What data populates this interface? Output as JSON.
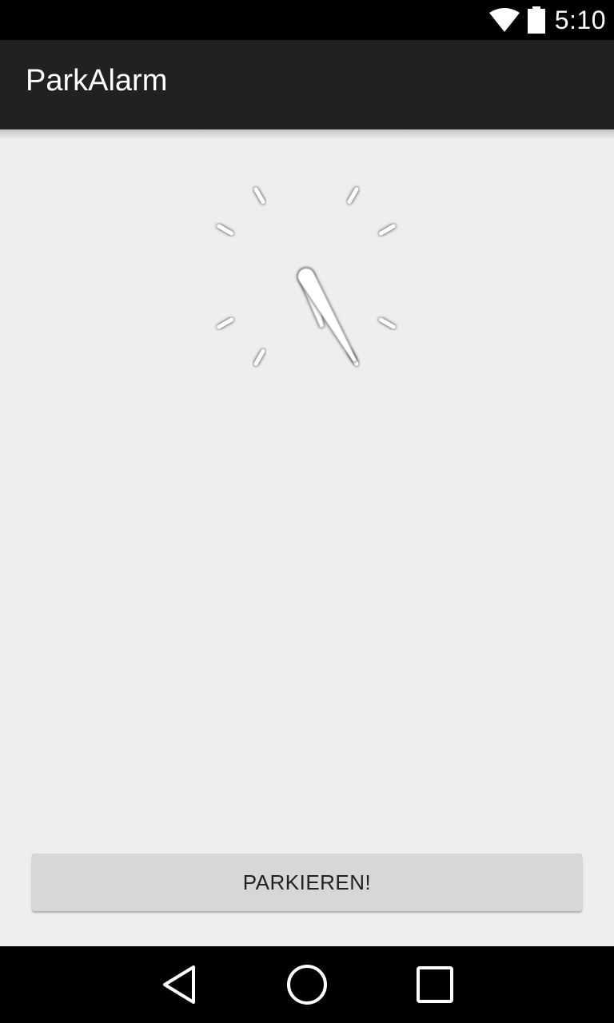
{
  "status_bar": {
    "time": "5:10",
    "icons": [
      "wifi-icon",
      "battery-icon"
    ]
  },
  "app_bar": {
    "title": "ParkAlarm"
  },
  "clock": {
    "type": "analog-clock",
    "hour": 5,
    "minute": 25,
    "tick_marks": 12
  },
  "main": {
    "park_button_label": "PARKIEREN!"
  },
  "nav_bar": {
    "buttons": [
      "back-icon",
      "home-icon",
      "recents-icon"
    ]
  },
  "colors": {
    "status_bar": "#000000",
    "app_bar": "#212121",
    "background": "#eeeeee",
    "button": "#d6d7d7",
    "button_text": "#212121"
  }
}
